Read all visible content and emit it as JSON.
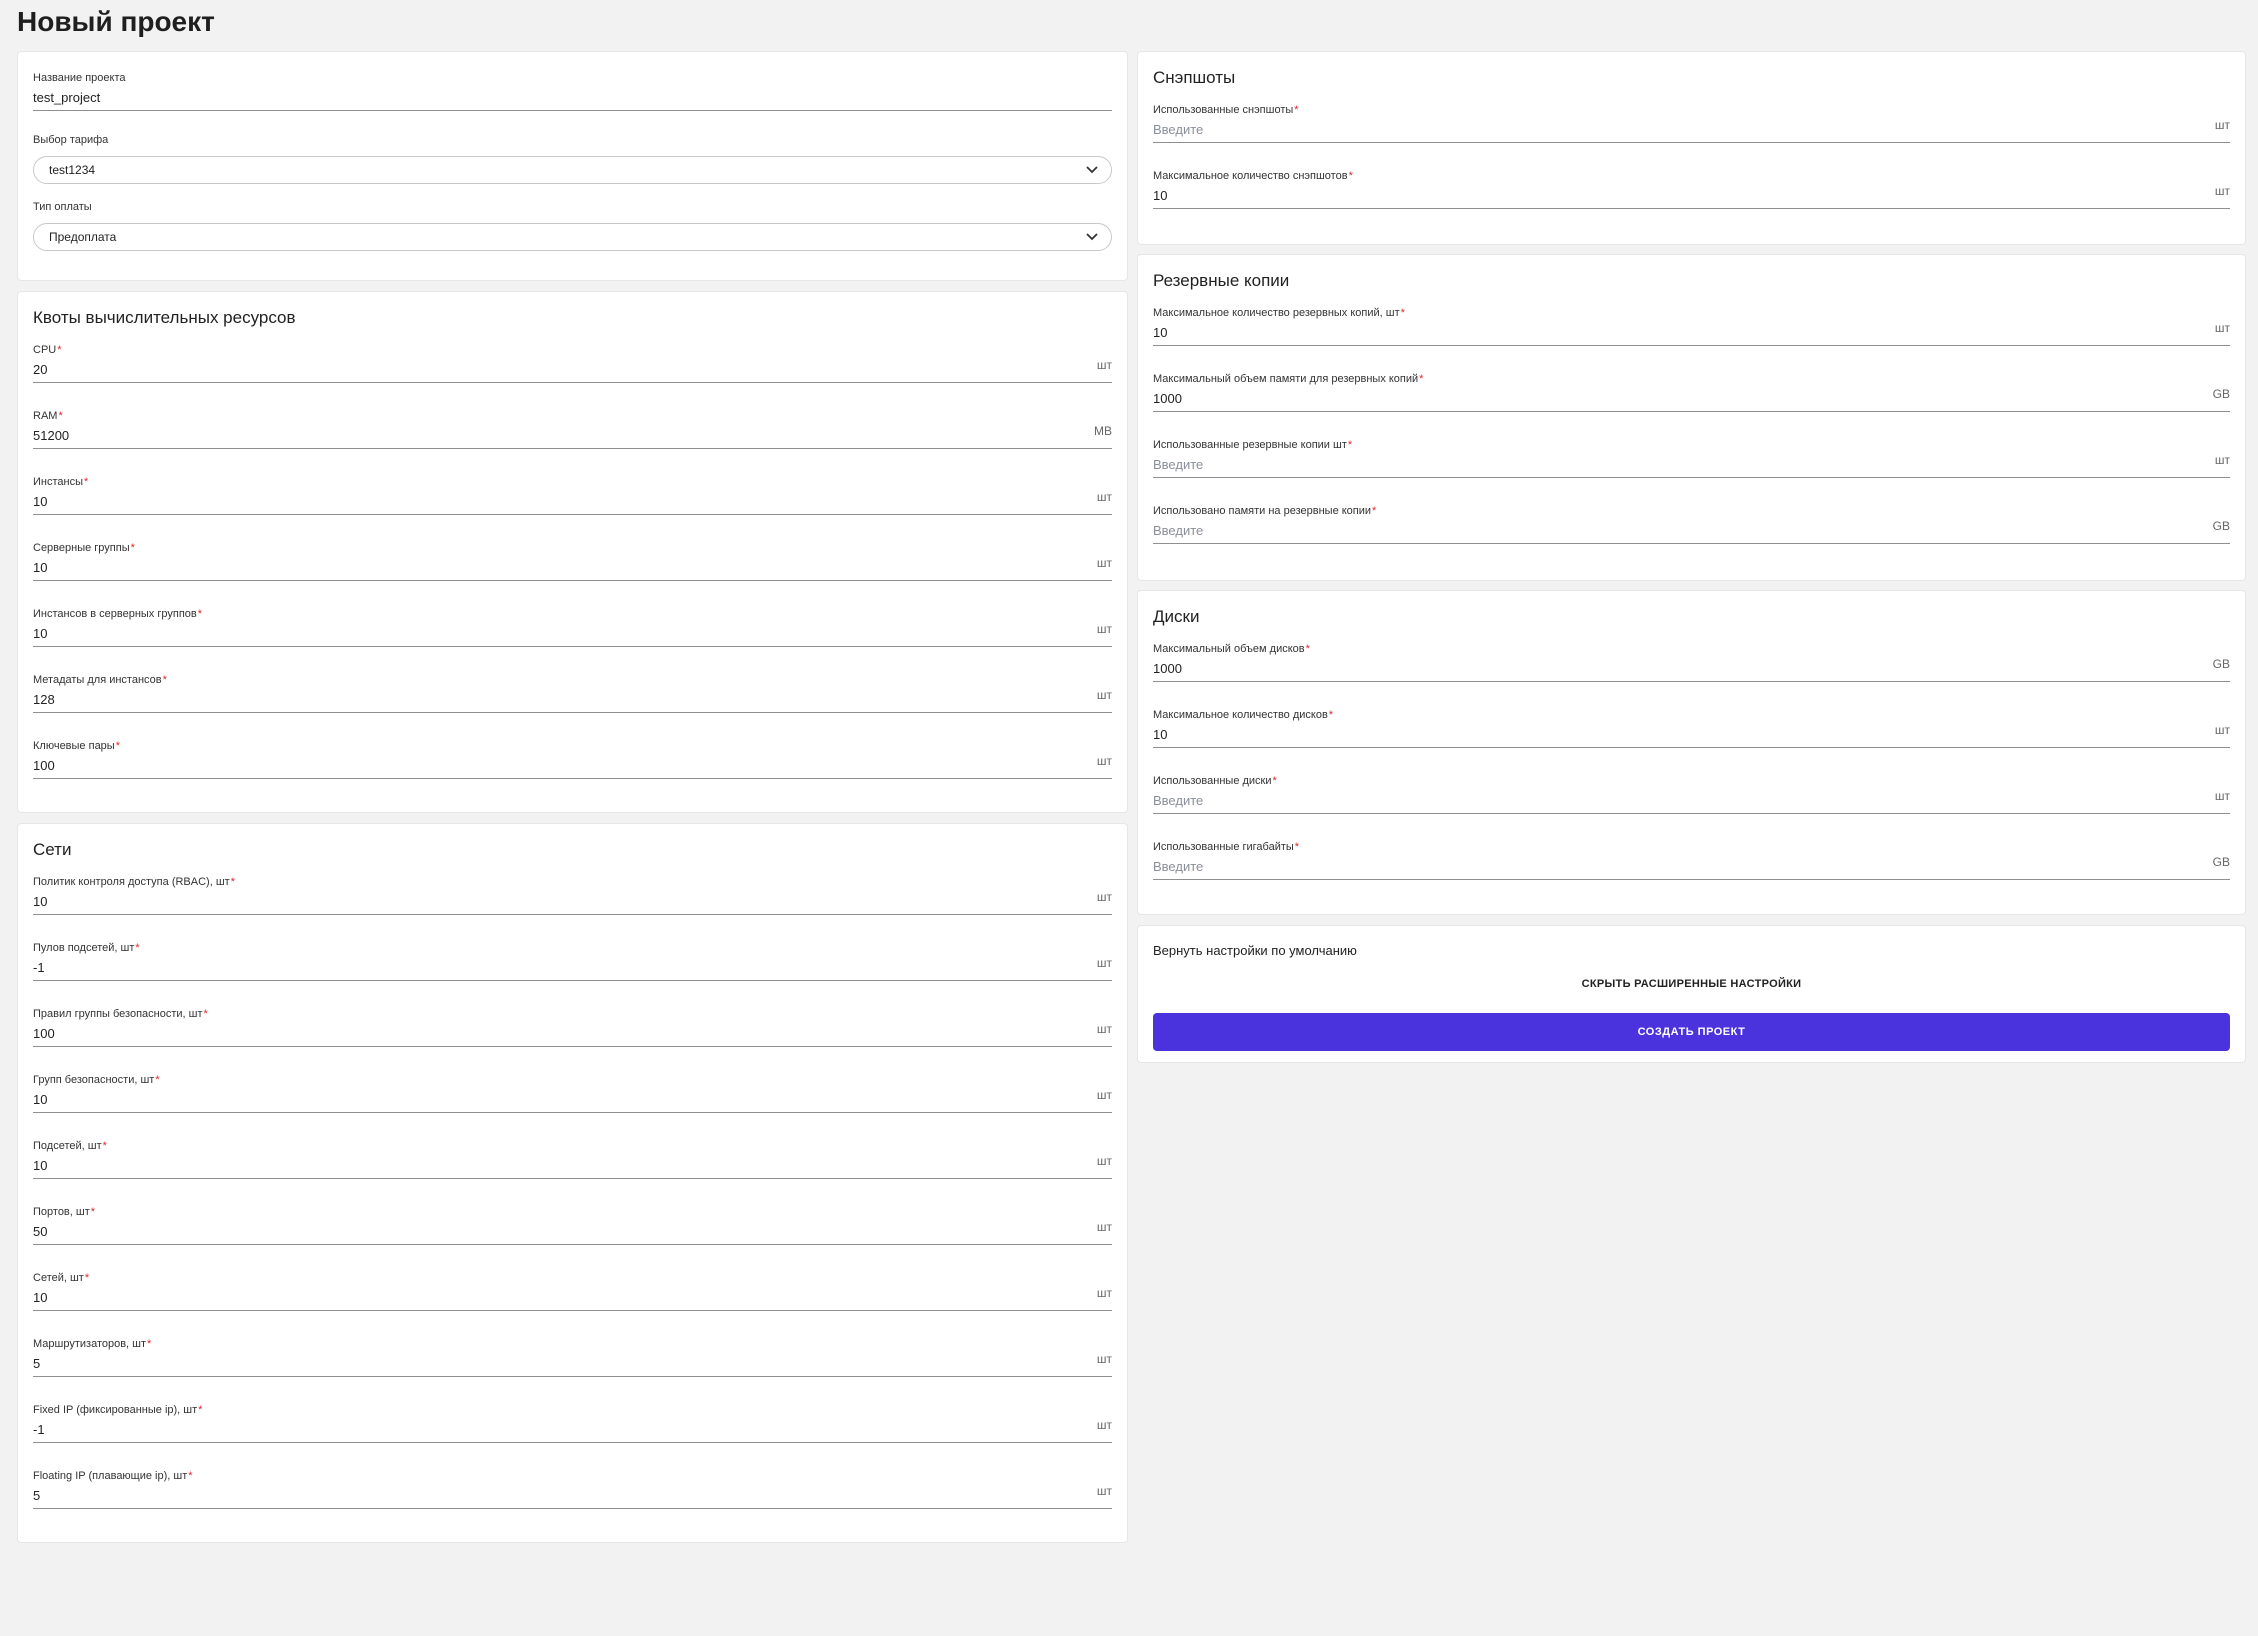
{
  "page": {
    "title": "Новый проект"
  },
  "project": {
    "name_label": "Название проекта",
    "name_value": "test_project",
    "tariff_label": "Выбор тарифа",
    "tariff_value": "test1234",
    "payment_label": "Тип оплаты",
    "payment_value": "Предоплата"
  },
  "compute": {
    "title": "Квоты вычислительных ресурсов",
    "fields": [
      {
        "label": "CPU",
        "value": "20",
        "unit": "шт"
      },
      {
        "label": "RAM",
        "value": "51200",
        "unit": "MB"
      },
      {
        "label": "Инстансы",
        "value": "10",
        "unit": "шт"
      },
      {
        "label": "Серверные группы",
        "value": "10",
        "unit": "шт"
      },
      {
        "label": "Инстансов в серверных группов",
        "value": "10",
        "unit": "шт"
      },
      {
        "label": "Метадаты для инстансов",
        "value": "128",
        "unit": "шт"
      },
      {
        "label": "Ключевые пары",
        "value": "100",
        "unit": "шт"
      }
    ]
  },
  "networks": {
    "title": "Сети",
    "fields": [
      {
        "label": "Политик контроля доступа (RBAC), шт",
        "value": "10",
        "unit": "шт"
      },
      {
        "label": "Пулов подсетей, шт",
        "value": "-1",
        "unit": "шт"
      },
      {
        "label": "Правил группы безопасности, шт",
        "value": "100",
        "unit": "шт"
      },
      {
        "label": "Групп безопасности, шт",
        "value": "10",
        "unit": "шт"
      },
      {
        "label": "Подсетей, шт",
        "value": "10",
        "unit": "шт"
      },
      {
        "label": "Портов, шт",
        "value": "50",
        "unit": "шт"
      },
      {
        "label": "Сетей, шт",
        "value": "10",
        "unit": "шт"
      },
      {
        "label": "Маршрутизаторов, шт",
        "value": "5",
        "unit": "шт"
      },
      {
        "label": "Fixed IP (фиксированные ip), шт",
        "value": "-1",
        "unit": "шт"
      },
      {
        "label": "Floating IP (плавающие ip), шт",
        "value": "5",
        "unit": "шт"
      }
    ]
  },
  "snapshots": {
    "title": "Снэпшоты",
    "fields": [
      {
        "label": "Использованные снэпшоты",
        "value": "",
        "placeholder": "Введите",
        "unit": "шт"
      },
      {
        "label": "Максимальное количество снэпшотов",
        "value": "10",
        "unit": "шт"
      }
    ]
  },
  "backups": {
    "title": "Резервные копии",
    "fields": [
      {
        "label": "Максимальное количество резервных копий, шт",
        "value": "10",
        "unit": "шт"
      },
      {
        "label": "Максимальный объем памяти для резервных копий",
        "value": "1000",
        "unit": "GB"
      },
      {
        "label": "Использованные резервные копии шт",
        "value": "",
        "placeholder": "Введите",
        "unit": "шт"
      },
      {
        "label": "Использовано памяти на резервные копии",
        "value": "",
        "placeholder": "Введите",
        "unit": "GB"
      }
    ]
  },
  "disks": {
    "title": "Диски",
    "fields": [
      {
        "label": "Максимальный объем дисков",
        "value": "1000",
        "unit": "GB"
      },
      {
        "label": "Максимальное количество дисков",
        "value": "10",
        "unit": "шт"
      },
      {
        "label": "Использованные диски",
        "value": "",
        "placeholder": "Введите",
        "unit": "шт"
      },
      {
        "label": "Использованные гигабайты",
        "value": "",
        "placeholder": "Введите",
        "unit": "GB"
      }
    ]
  },
  "actions": {
    "reset_label": "Вернуть настройки по умолчанию",
    "toggle_label": "СКРЫТЬ РАСШИРЕННЫЕ НАСТРОЙКИ",
    "create_label": "СОЗДАТЬ ПРОЕКТ"
  },
  "colors": {
    "accent": "#4a33dc",
    "required": "#e0262c"
  }
}
